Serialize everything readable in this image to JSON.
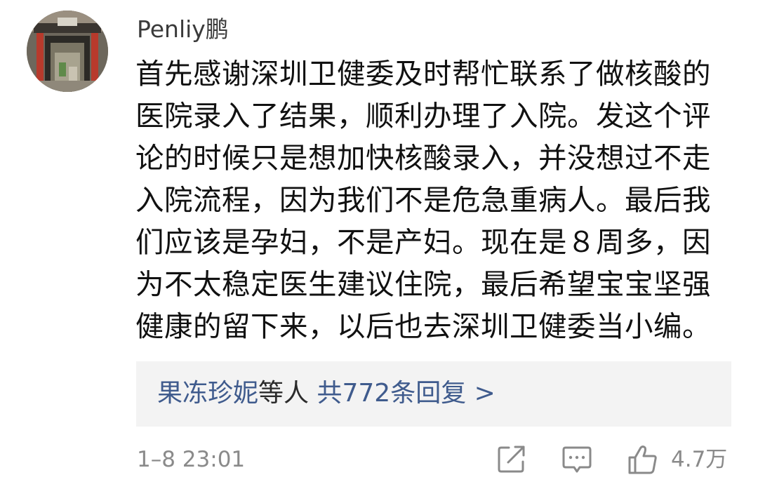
{
  "comment": {
    "username": "Penliy鹏",
    "lines": [
      "首先感谢深圳卫健委及时帮忙联系了做核酸的",
      "医院录入了结果，顺利办理了入院。发这个评",
      "论的时候只是想加快核酸录入，并没想过不走",
      "入院流程，因为我们不是危急重病人。最后我",
      "们应该是孕妇，不是产妇。现在是８周多，因",
      "为不太稳定医生建议住院，最后希望宝宝坚强",
      "健康的留下来，以后也去深圳卫健委当小编。"
    ],
    "timestamp": "1–8 23:01",
    "likes": "4.7万"
  },
  "replies": {
    "user": "果冻珍妮",
    "mid": "等人",
    "count_text": "共772条回复 >"
  },
  "icons": {
    "share": "share-icon",
    "reply": "comment-icon",
    "like": "thumbs-up-icon"
  },
  "colors": {
    "link": "#3f5b8d",
    "muted": "#8a8a8a",
    "reply_bg": "#f3f3f3"
  }
}
